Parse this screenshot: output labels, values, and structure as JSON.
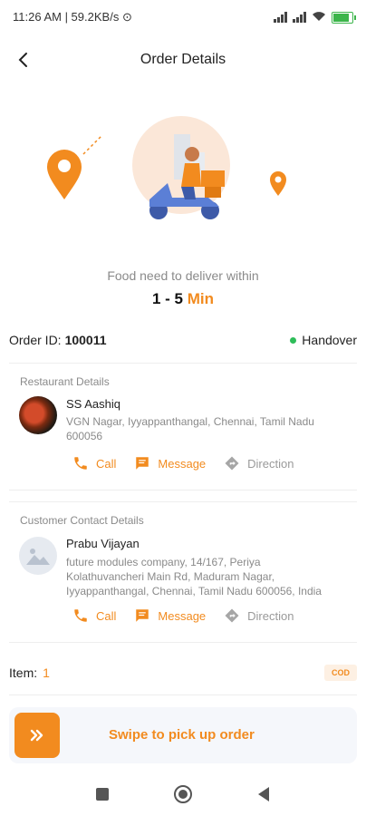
{
  "status_bar": {
    "time_speed": "11:26 AM | 59.2KB/s"
  },
  "header": {
    "title": "Order Details"
  },
  "delivery": {
    "label": "Food need to deliver within",
    "range": "1 - 5",
    "unit": "Min"
  },
  "order": {
    "id_label": "Order ID:",
    "id_value": "100011",
    "status": "Handover"
  },
  "restaurant": {
    "section_title": "Restaurant Details",
    "name": "SS Aashiq",
    "address": "VGN Nagar, Iyyappanthangal, Chennai, Tamil Nadu 600056",
    "actions": {
      "call": "Call",
      "message": "Message",
      "direction": "Direction"
    }
  },
  "customer": {
    "section_title": "Customer Contact Details",
    "name": "Prabu Vijayan",
    "address": "future modules company, 14/167, Periya Kolathuvancheri Main Rd, Maduram Nagar, Iyyappanthangal, Chennai, Tamil Nadu 600056, India",
    "actions": {
      "call": "Call",
      "message": "Message",
      "direction": "Direction"
    }
  },
  "items": {
    "label": "Item:",
    "count": "1",
    "payment": "COD"
  },
  "swipe": {
    "label": "Swipe to pick up order"
  },
  "colors": {
    "accent": "#f28b1f",
    "status_green": "#2ebd59"
  }
}
